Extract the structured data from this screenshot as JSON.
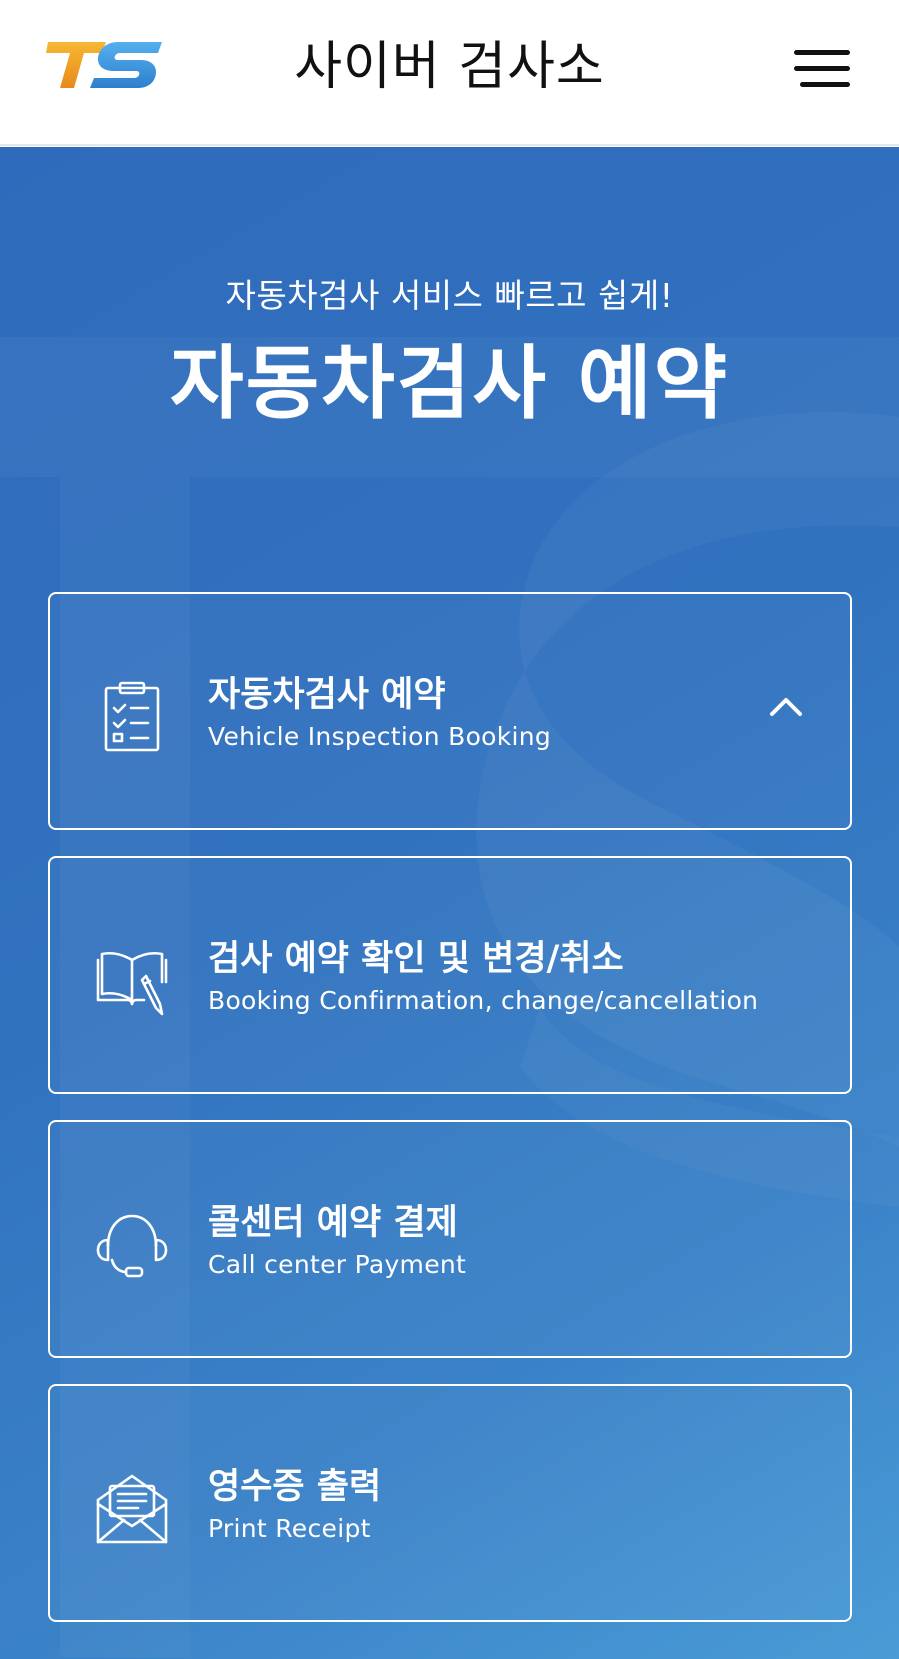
{
  "header": {
    "logo_text": "TS",
    "title": "사이버 검사소"
  },
  "hero": {
    "subtitle": "자동차검사 서비스 빠르고 쉽게!",
    "title": "자동차검사 예약"
  },
  "cards": [
    {
      "title": "자동차검사 예약",
      "subtitle": "Vehicle Inspection Booking",
      "icon": "clipboard-checklist-icon",
      "expanded": true
    },
    {
      "title": "검사 예약 확인 및 변경/취소",
      "subtitle": "Booking Confirmation, change/cancellation",
      "icon": "book-pen-icon"
    },
    {
      "title": "콜센터 예약 결제",
      "subtitle": "Call center Payment",
      "icon": "headset-icon"
    },
    {
      "title": "영수증 출력",
      "subtitle": "Print Receipt",
      "icon": "envelope-receipt-icon"
    }
  ],
  "colors": {
    "logo_orange": "#f0a020",
    "logo_blue": "#3a8fd8",
    "hero_blue": "#3172bf",
    "white": "#ffffff"
  }
}
